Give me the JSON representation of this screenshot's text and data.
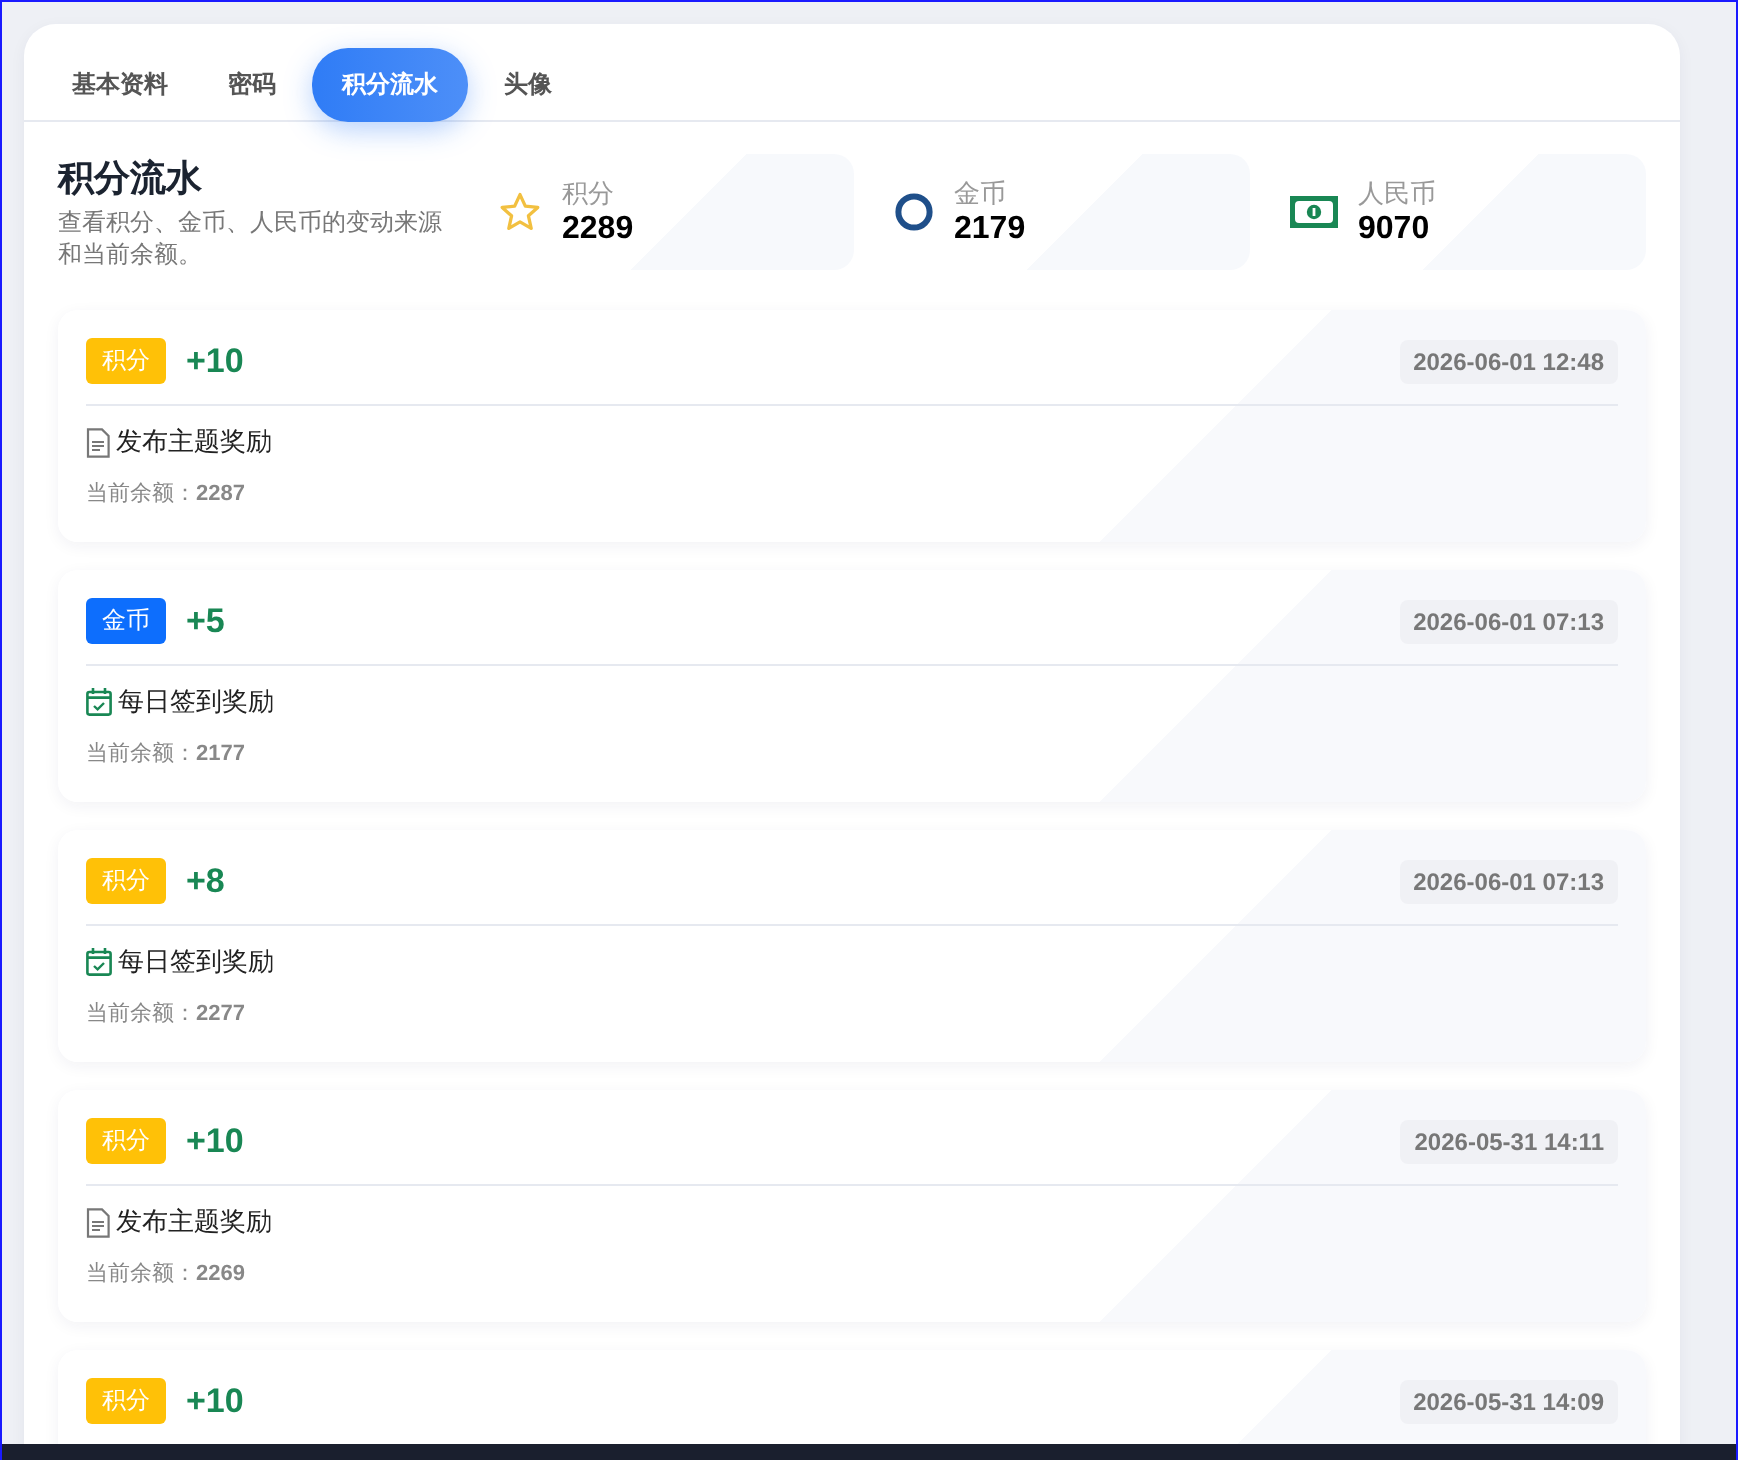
{
  "tabs": [
    {
      "label": "基本资料",
      "selected": false
    },
    {
      "label": "密码",
      "selected": false
    },
    {
      "label": "积分流水",
      "selected": true
    },
    {
      "label": "头像",
      "selected": false
    }
  ],
  "header": {
    "title": "积分流水",
    "description": "查看积分、金币、人民币的变动来源和当前余额。"
  },
  "stats": [
    {
      "kind": "points",
      "label": "积分",
      "value": "2289"
    },
    {
      "kind": "coins",
      "label": "金币",
      "value": "2179"
    },
    {
      "kind": "cash",
      "label": "人民币",
      "value": "9070"
    }
  ],
  "entries": [
    {
      "kind": "points",
      "badge": "积分",
      "amount": "+10",
      "time": "2026-06-01 12:48",
      "source": {
        "kind": "document",
        "text": "发布主题奖励"
      },
      "balance_label": "当前余额：",
      "balance": "2287"
    },
    {
      "kind": "coins",
      "badge": "金币",
      "amount": "+5",
      "time": "2026-06-01 07:13",
      "source": {
        "kind": "calendar",
        "text": "每日签到奖励"
      },
      "balance_label": "当前余额：",
      "balance": "2177"
    },
    {
      "kind": "points",
      "badge": "积分",
      "amount": "+8",
      "time": "2026-06-01 07:13",
      "source": {
        "kind": "calendar",
        "text": "每日签到奖励"
      },
      "balance_label": "当前余额：",
      "balance": "2277"
    },
    {
      "kind": "points",
      "badge": "积分",
      "amount": "+10",
      "time": "2026-05-31 14:11",
      "source": {
        "kind": "document",
        "text": "发布主题奖励"
      },
      "balance_label": "当前余额：",
      "balance": "2269"
    },
    {
      "kind": "points",
      "badge": "积分",
      "amount": "+10",
      "time": "2026-05-31 14:09"
    }
  ]
}
